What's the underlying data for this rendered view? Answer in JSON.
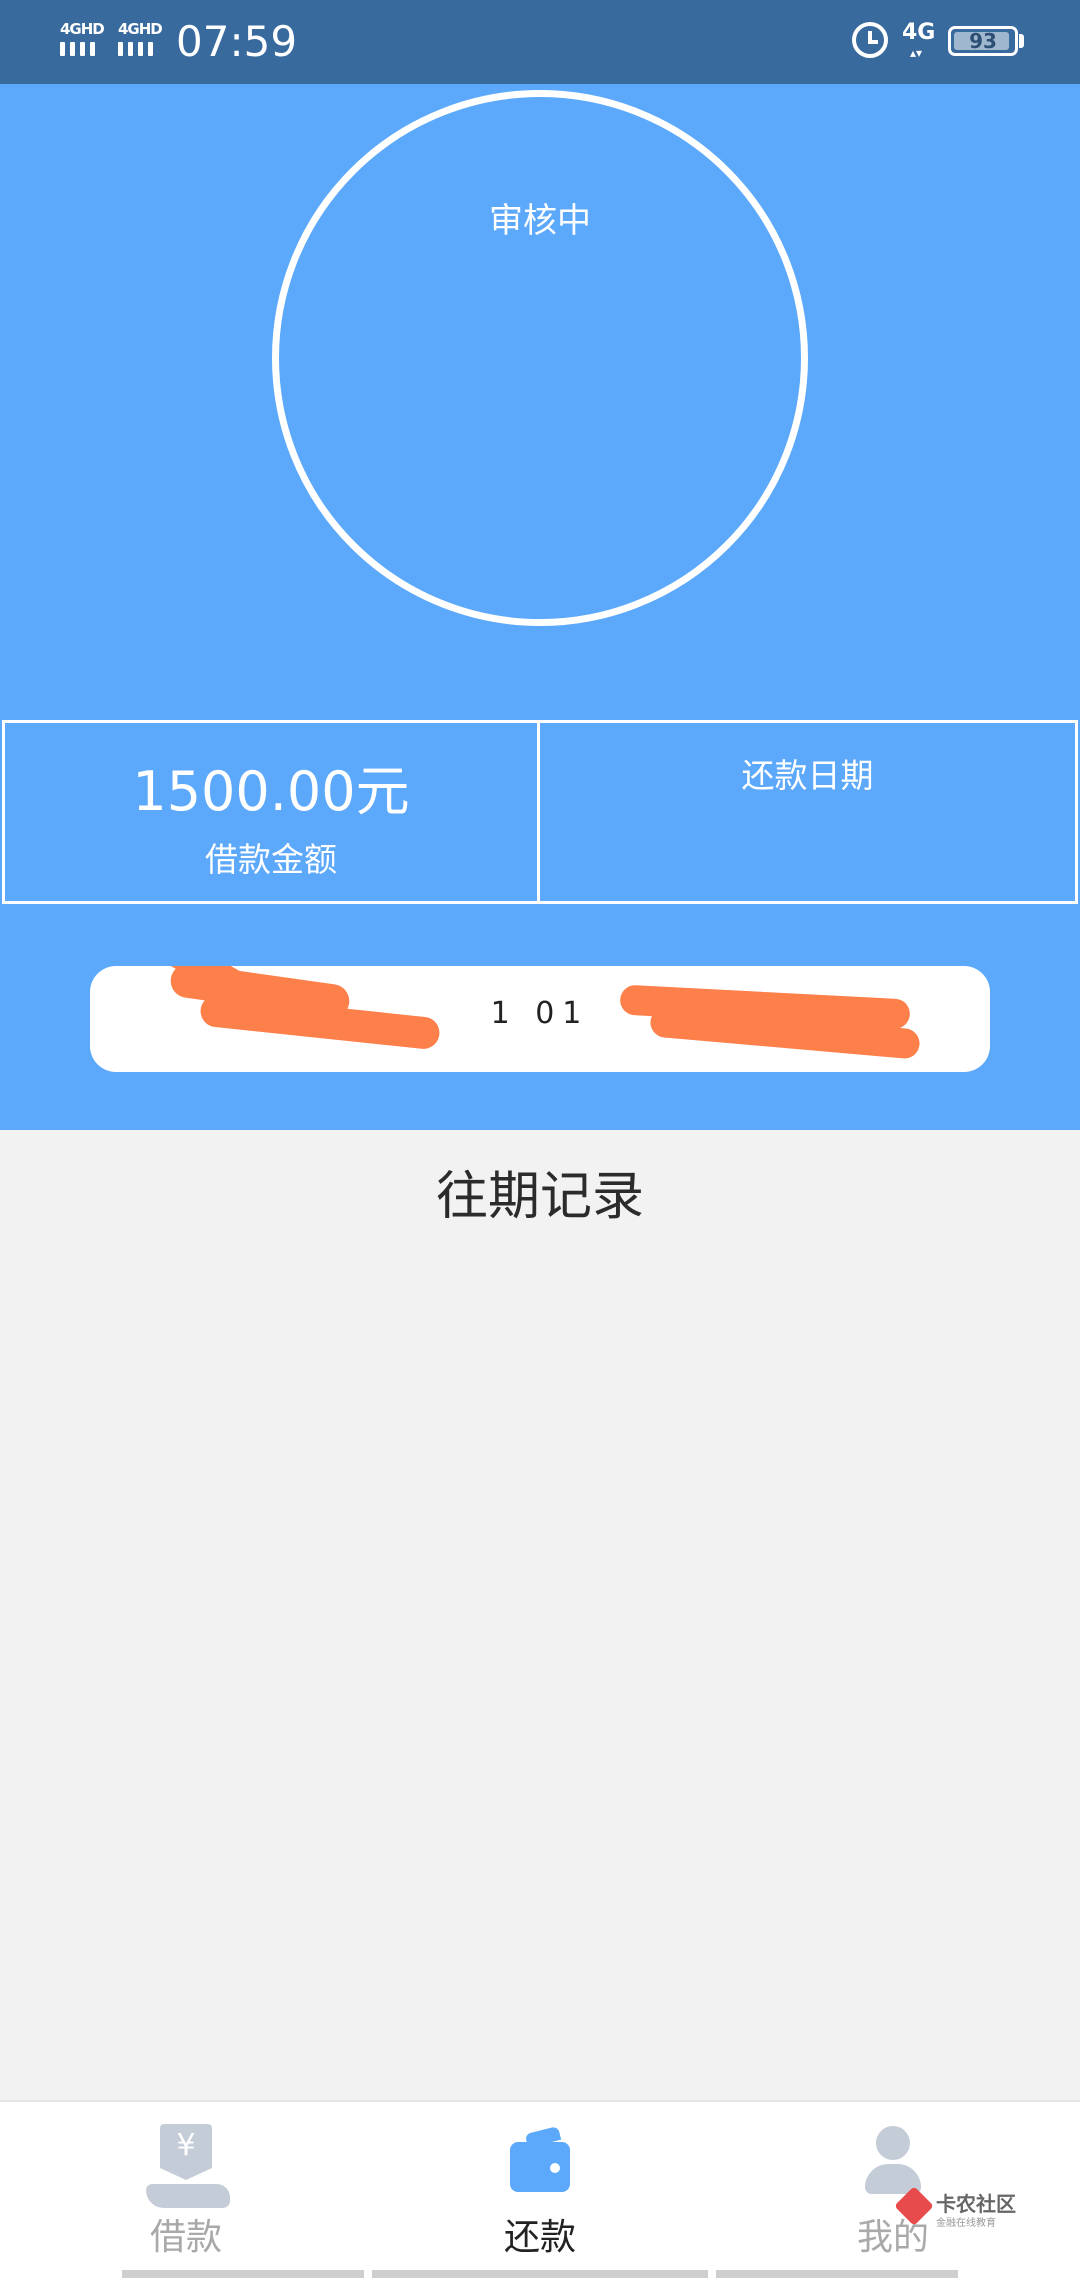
{
  "status_bar": {
    "network_1": "4GHD",
    "network_2": "4GHD",
    "time": "07:59",
    "data_network": "4G",
    "data_arrows": "▴▾",
    "battery": "93"
  },
  "hero": {
    "status_text": "审核中"
  },
  "loan_info": {
    "amount": "1500.00元",
    "amount_label": "借款金额",
    "repay_date_label": "还款日期"
  },
  "notice": {
    "text": "1 01"
  },
  "history": {
    "title": "往期记录"
  },
  "nav": {
    "items": [
      {
        "label": "借款",
        "icon": "yen-hand-icon"
      },
      {
        "label": "还款",
        "icon": "wallet-icon"
      },
      {
        "label": "我的",
        "icon": "user-icon"
      }
    ]
  },
  "watermark": {
    "title": "卡农社区",
    "subtitle": "金融在线教育"
  },
  "colors": {
    "status_bar": "#386a9e",
    "primary": "#5ca9fb",
    "background": "#f2f2f2",
    "scribble": "#fd7f4a"
  }
}
